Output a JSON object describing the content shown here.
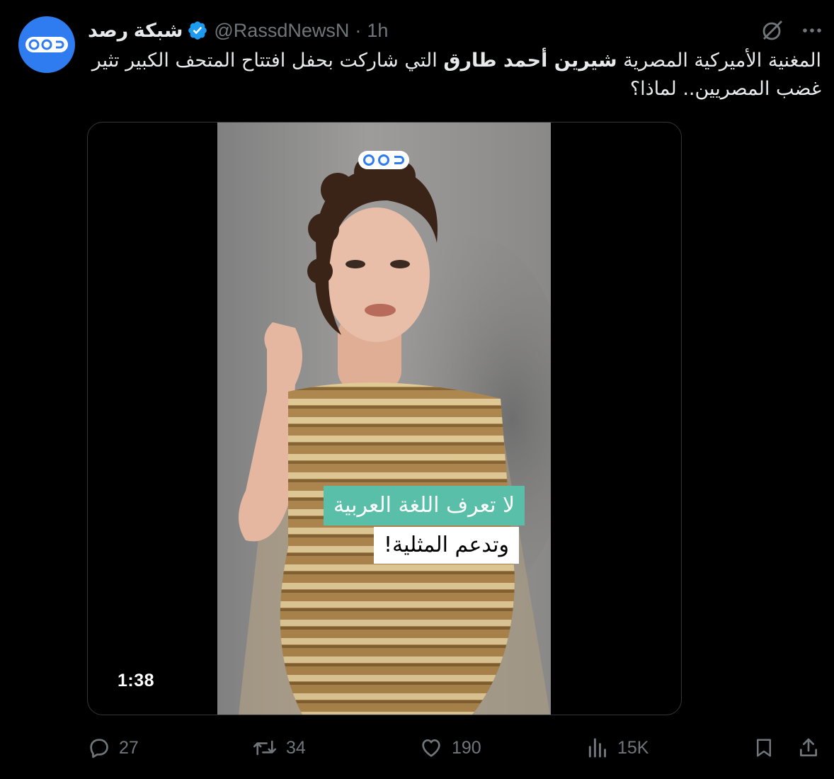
{
  "tweet": {
    "display_name": "شبكة رصد",
    "handle": "@RassdNewsN",
    "separator": "·",
    "time": "1h",
    "text_part1": "المغنية الأميركية المصرية ",
    "text_bold": "شيرين أحمد طارق",
    "text_part2": " التي شاركت بحفل افتتاح المتحف الكبير تثير غضب المصريين.. لماذا؟"
  },
  "media": {
    "caption_line1": "لا تعرف اللغة العربية",
    "caption_line2": "وتدعم المثلية!",
    "duration": "1:38"
  },
  "actions": {
    "replies": "27",
    "reposts": "34",
    "likes": "190",
    "views": "15K"
  },
  "icons": {
    "avatar": "rassd-logo-icon",
    "verified": "verified-badge-icon",
    "grok": "grok-icon",
    "more": "more-icon",
    "reply": "reply-icon",
    "repost": "repost-icon",
    "like": "heart-icon",
    "views": "views-icon",
    "bookmark": "bookmark-icon",
    "share": "share-icon"
  },
  "colors": {
    "background": "#000000",
    "text": "#e7e9ea",
    "muted": "#71767b",
    "avatar": "#2f7cf0",
    "verified": "#1d9bf0",
    "caption_highlight": "#5abfa9"
  }
}
